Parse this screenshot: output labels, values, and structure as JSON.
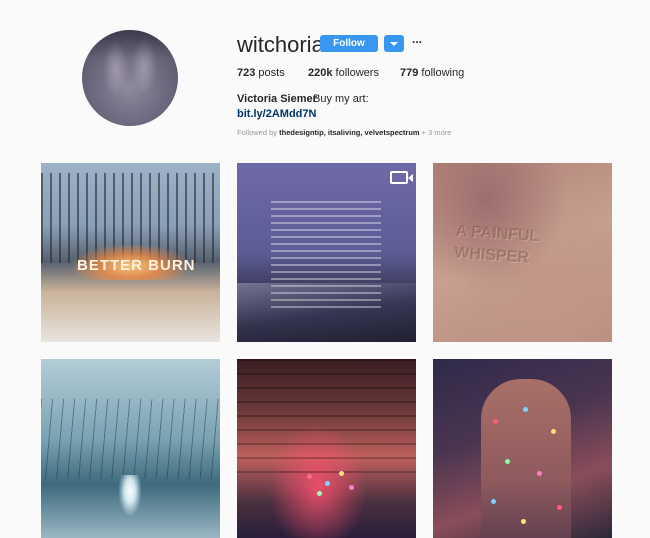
{
  "profile": {
    "username": "witchoria",
    "follow_label": "Follow",
    "more_label": "...",
    "posts_count": "723",
    "posts_label": "posts",
    "followers_count": "220k",
    "followers_label": "followers",
    "following_count": "779",
    "following_label": "following",
    "full_name": "Victoria Siemer",
    "bio": "Buy my art:",
    "link": "bit.ly/2AMdd7N",
    "followed_by_prefix": "Followed by",
    "followed_by_users": "thedesigntip, itsaliving, velvetspectrum",
    "followed_by_more": "+ 3 more"
  },
  "posts": [
    {
      "overlay_text": "BETTER BURN",
      "type": "photo"
    },
    {
      "overlay_text": "",
      "type": "video",
      "icon": "video-icon"
    },
    {
      "overlay_text": "A PAINFUL WHISPER",
      "type": "photo"
    },
    {
      "overlay_text": "",
      "type": "photo"
    },
    {
      "overlay_text": "",
      "type": "photo"
    },
    {
      "overlay_text": "",
      "type": "photo"
    }
  ],
  "colors": {
    "accent": "#3897f0",
    "link": "#003569",
    "muted": "#999999",
    "background": "#fafafa"
  }
}
